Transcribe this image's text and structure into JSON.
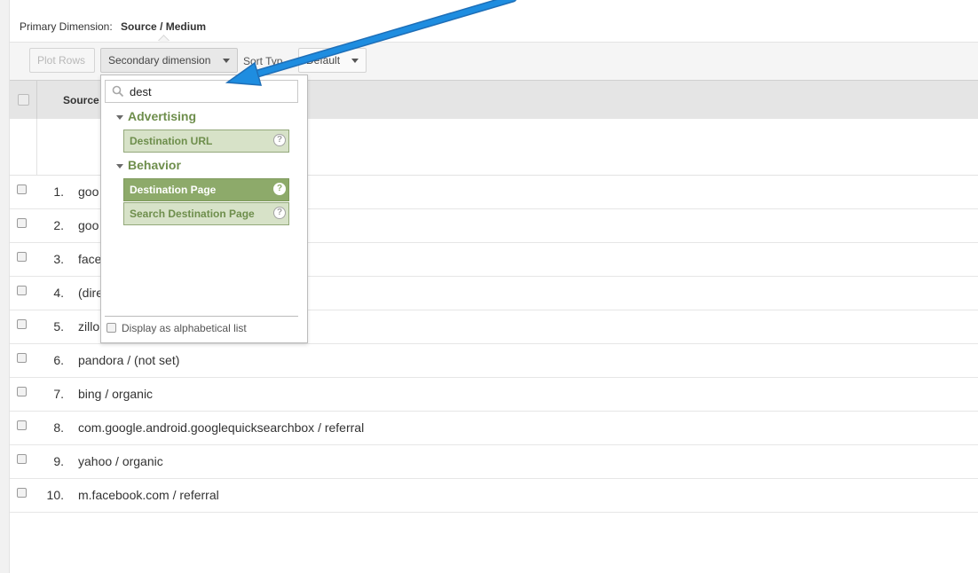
{
  "primary_dimension": {
    "label": "Primary Dimension:",
    "value": "Source / Medium"
  },
  "toolbar": {
    "plot_rows": "Plot Rows",
    "secondary_dimension": "Secondary dimension",
    "sort_type": "Sort Typ",
    "sort_value": "Default"
  },
  "table": {
    "header_source": "Source",
    "rows": [
      {
        "num": "1.",
        "source": "goo"
      },
      {
        "num": "2.",
        "source": "goo"
      },
      {
        "num": "3.",
        "source": "face"
      },
      {
        "num": "4.",
        "source": "(dire"
      },
      {
        "num": "5.",
        "source": "zillo"
      },
      {
        "num": "6.",
        "source": "pandora / (not set)"
      },
      {
        "num": "7.",
        "source": "bing / organic"
      },
      {
        "num": "8.",
        "source": "com.google.android.googlequicksearchbox / referral"
      },
      {
        "num": "9.",
        "source": "yahoo / organic"
      },
      {
        "num": "10.",
        "source": "m.facebook.com / referral"
      }
    ]
  },
  "dropdown": {
    "search_value": "dest",
    "groups": [
      {
        "name": "Advertising",
        "items": [
          {
            "label": "Destination URL",
            "selected": false
          }
        ]
      },
      {
        "name": "Behavior",
        "items": [
          {
            "label": "Destination Page",
            "selected": true
          },
          {
            "label": "Search Destination Page",
            "selected": false
          }
        ]
      }
    ],
    "alphabetical_label": "Display as alphabetical list",
    "help_glyph": "?"
  },
  "colors": {
    "group_green": "#6e8e4c",
    "item_bg": "#d7e2c8",
    "item_selected_bg": "#8daa6a",
    "arrow_blue": "#1e8de0"
  }
}
